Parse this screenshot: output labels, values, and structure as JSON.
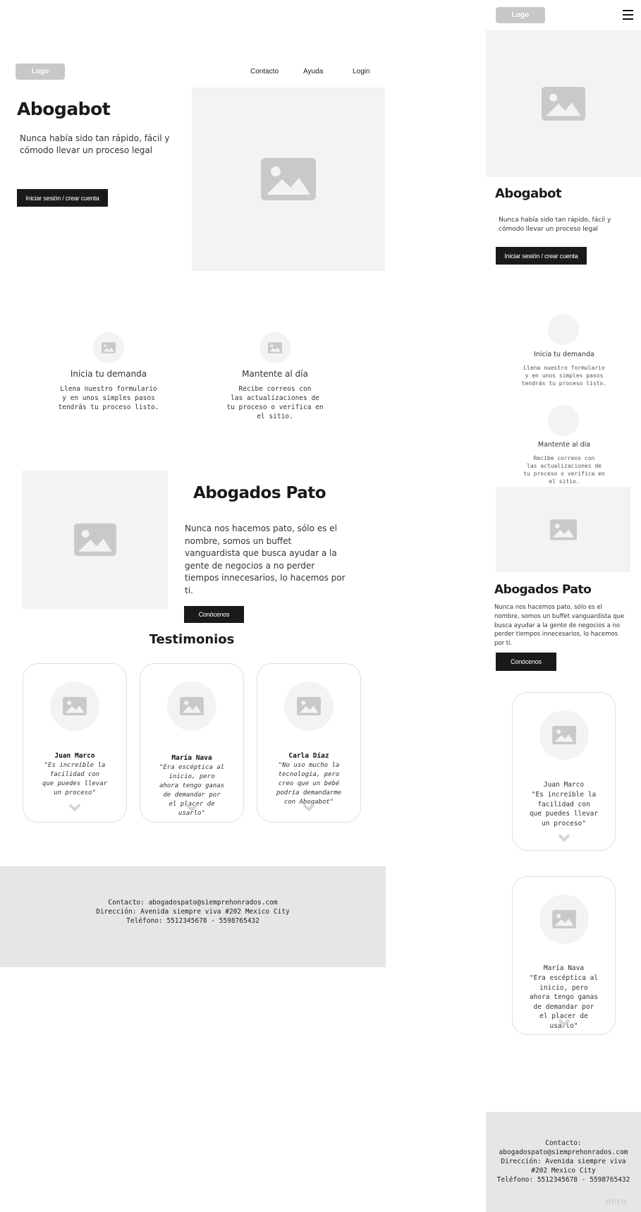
{
  "brand": {
    "logo": "Logo"
  },
  "nav": {
    "contacto": "Contacto",
    "ayuda": "Ayuda",
    "login": "Login"
  },
  "hero": {
    "title": "Abogabot",
    "subtitle": "Nunca había sido tan rápido, fácil y cómodo llevar un proceso legal",
    "cta": "Iniciar sesión / crear cuenta"
  },
  "features": [
    {
      "title": "Inicia tu demanda",
      "text": "Llena nuestro formulario\ny en unos simples pasos\ntendrás tu proceso listo."
    },
    {
      "title": "Mantente al día",
      "text": "Recibe correos con\nlas actualizaciones de\ntu proceso o verifica en\nel sitio."
    }
  ],
  "about": {
    "title": "Abogados Pato",
    "text": "Nunca nos hacemos pato, sólo es el nombre, somos un buffet vanguardista que busca ayudar a la gente de negocios a no perder tiempos innecesarios, lo hacemos por ti.",
    "cta": "Conócenos"
  },
  "testimonials": {
    "title": "Testimonios",
    "items": [
      {
        "name": "Juan Marco",
        "quote": "\"Es increíble la\nfacilidad con\nque puedes llevar\nun proceso\""
      },
      {
        "name": "María Nava",
        "quote": "\"Era escéptica al\ninicio, pero\nahora tengo ganas\nde demandar por\nel placer de\nusarlo\""
      },
      {
        "name": "Carla Díaz",
        "quote": "\"No uso mucho la\ntecnología, pero\ncreo que un bebé\npodría demandarme\ncon Abogabot\""
      }
    ]
  },
  "footer": {
    "contacto": "Contacto: abogadospato@siemprehonrados.com",
    "direccion": "Dirección: Avenida siempre viva #202 Mexico City",
    "telefono": "Teléfono: 5512345678 - 5598765432",
    "m_contacto_label": "Contacto:",
    "m_contacto_email": "abogadospato@siemprehonrados.com",
    "m_direccion": "Dirección: Avenida siempre viva\n#202 Mexico City",
    "m_telefono": "Teléfono: 5512345678 - 5598765432"
  },
  "watermark": "miro",
  "icons": {
    "image": "image-placeholder-icon",
    "menu": "hamburger-menu-icon",
    "chevron": "chevron-down-icon"
  },
  "colors": {
    "dark": "#1a1a1a",
    "placeholder": "#f3f3f3",
    "footer": "#e6e6e6",
    "logo": "#c8c8c8"
  }
}
